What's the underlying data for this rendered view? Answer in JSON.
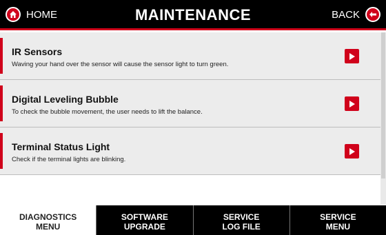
{
  "header": {
    "home_label": "HOME",
    "title": "MAINTENANCE",
    "back_label": "BACK",
    "accent_color": "#d0021b"
  },
  "items": [
    {
      "name": "IR Sensors",
      "description": "Waving your hand over the sensor will cause the sensor light to turn green.",
      "icon": "play-icon"
    },
    {
      "name": "Digital Leveling Bubble",
      "description": "To check the bubble movement, the user needs to lift the balance.",
      "icon": "play-icon"
    },
    {
      "name": "Terminal Status Light",
      "description": "Check if the terminal lights are blinking.",
      "icon": "play-icon"
    }
  ],
  "tabs": [
    {
      "label": "DIAGNOSTICS\nMENU",
      "active": true
    },
    {
      "label": "SOFTWARE\nUPGRADE",
      "active": false
    },
    {
      "label": "SERVICE\nLOG FILE",
      "active": false
    },
    {
      "label": "SERVICE\nMENU",
      "active": false
    }
  ]
}
